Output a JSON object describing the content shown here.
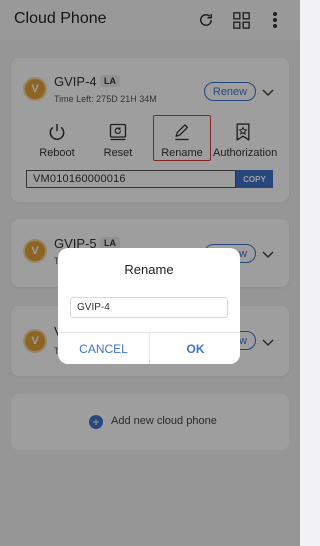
{
  "app": {
    "title": "Cloud Phone"
  },
  "header_icons": [
    "refresh-icon",
    "grid-icon",
    "more-icon"
  ],
  "colors": {
    "accent": "#3f73c9",
    "avatar": "#e3a23b",
    "highlight": "#d93b3b",
    "background": "#f2f2f4"
  },
  "devices": [
    {
      "avatar": "V",
      "name": "GVIP-4",
      "region": "LA",
      "time_left": "Time Left:  275D  21H  34M",
      "renew": "Renew",
      "actions": [
        "Reboot",
        "Reset",
        "Rename",
        "Authorization"
      ],
      "serial": "VM010160000016",
      "copy": "COPY"
    },
    {
      "avatar": "V",
      "name": "GVIP-5",
      "region": "LA",
      "time_left": "T",
      "renew": "Renew"
    },
    {
      "avatar": "V",
      "name": "V",
      "time_left": "T",
      "renew": "Renew"
    }
  ],
  "add_new": {
    "label": "Add new cloud phone"
  },
  "dialog": {
    "title": "Rename",
    "input_value": "GVIP-4",
    "cancel": "CANCEL",
    "ok": "OK"
  }
}
